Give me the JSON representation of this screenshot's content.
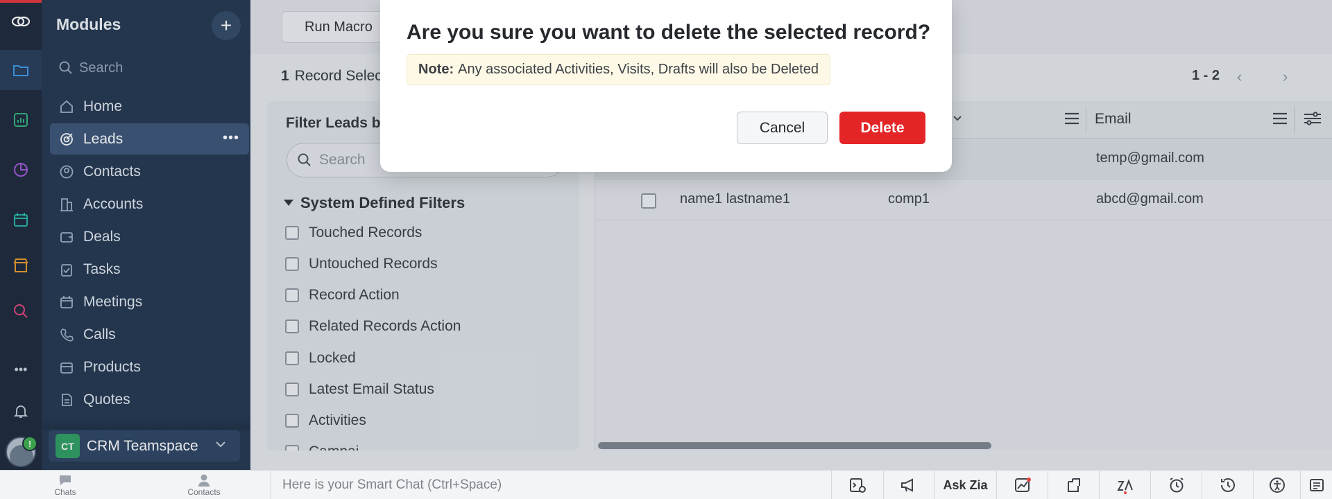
{
  "sidebar": {
    "title": "Modules",
    "search_placeholder": "Search",
    "items": [
      {
        "label": "Home"
      },
      {
        "label": "Leads"
      },
      {
        "label": "Contacts"
      },
      {
        "label": "Accounts"
      },
      {
        "label": "Deals"
      },
      {
        "label": "Tasks"
      },
      {
        "label": "Meetings"
      },
      {
        "label": "Calls"
      },
      {
        "label": "Products"
      },
      {
        "label": "Quotes"
      }
    ],
    "more_label": "•••",
    "team": {
      "initials": "CT",
      "name": "CRM Teamspace"
    }
  },
  "rail": {
    "more_label": "•••",
    "status_glyph": "!"
  },
  "toolbar": {
    "run_macro_label": "Run Macro"
  },
  "selection": {
    "count": "1",
    "label": "Record Selec"
  },
  "pager": {
    "range": "1 - 2",
    "prev": "‹",
    "next": "›"
  },
  "filters": {
    "title": "Filter Leads by",
    "search_placeholder": "Search",
    "group_label": "System Defined Filters",
    "items": [
      {
        "label": "Touched Records"
      },
      {
        "label": "Untouched Records"
      },
      {
        "label": "Record Action"
      },
      {
        "label": "Related Records Action"
      },
      {
        "label": "Locked"
      },
      {
        "label": "Latest Email Status"
      },
      {
        "label": "Activities"
      },
      {
        "label": "Campai"
      }
    ]
  },
  "table": {
    "columns": {
      "email": "Email"
    },
    "rows": [
      {
        "name": "",
        "company": "",
        "email": "temp@gmail.com"
      },
      {
        "name": "name1 lastname1",
        "company": "comp1",
        "email": "abcd@gmail.com"
      }
    ]
  },
  "bottombar": {
    "chats_label": "Chats",
    "contacts_label": "Contacts",
    "smartchat_placeholder": "Here is your Smart Chat (Ctrl+Space)",
    "ask_zia_label": "Ask Zia"
  },
  "modal": {
    "title": "Are you sure you want to delete the selected record?",
    "note_label": "Note:",
    "note_text": "Any associated Activities, Visits, Drafts will also be Deleted",
    "cancel_label": "Cancel",
    "delete_label": "Delete"
  },
  "colors": {
    "rail_bg": "#1e2a3c",
    "sidebar_bg": "#243750",
    "active_item": "#3b5478",
    "delete_button": "#e42527",
    "team_badge": "#2f9e63"
  }
}
